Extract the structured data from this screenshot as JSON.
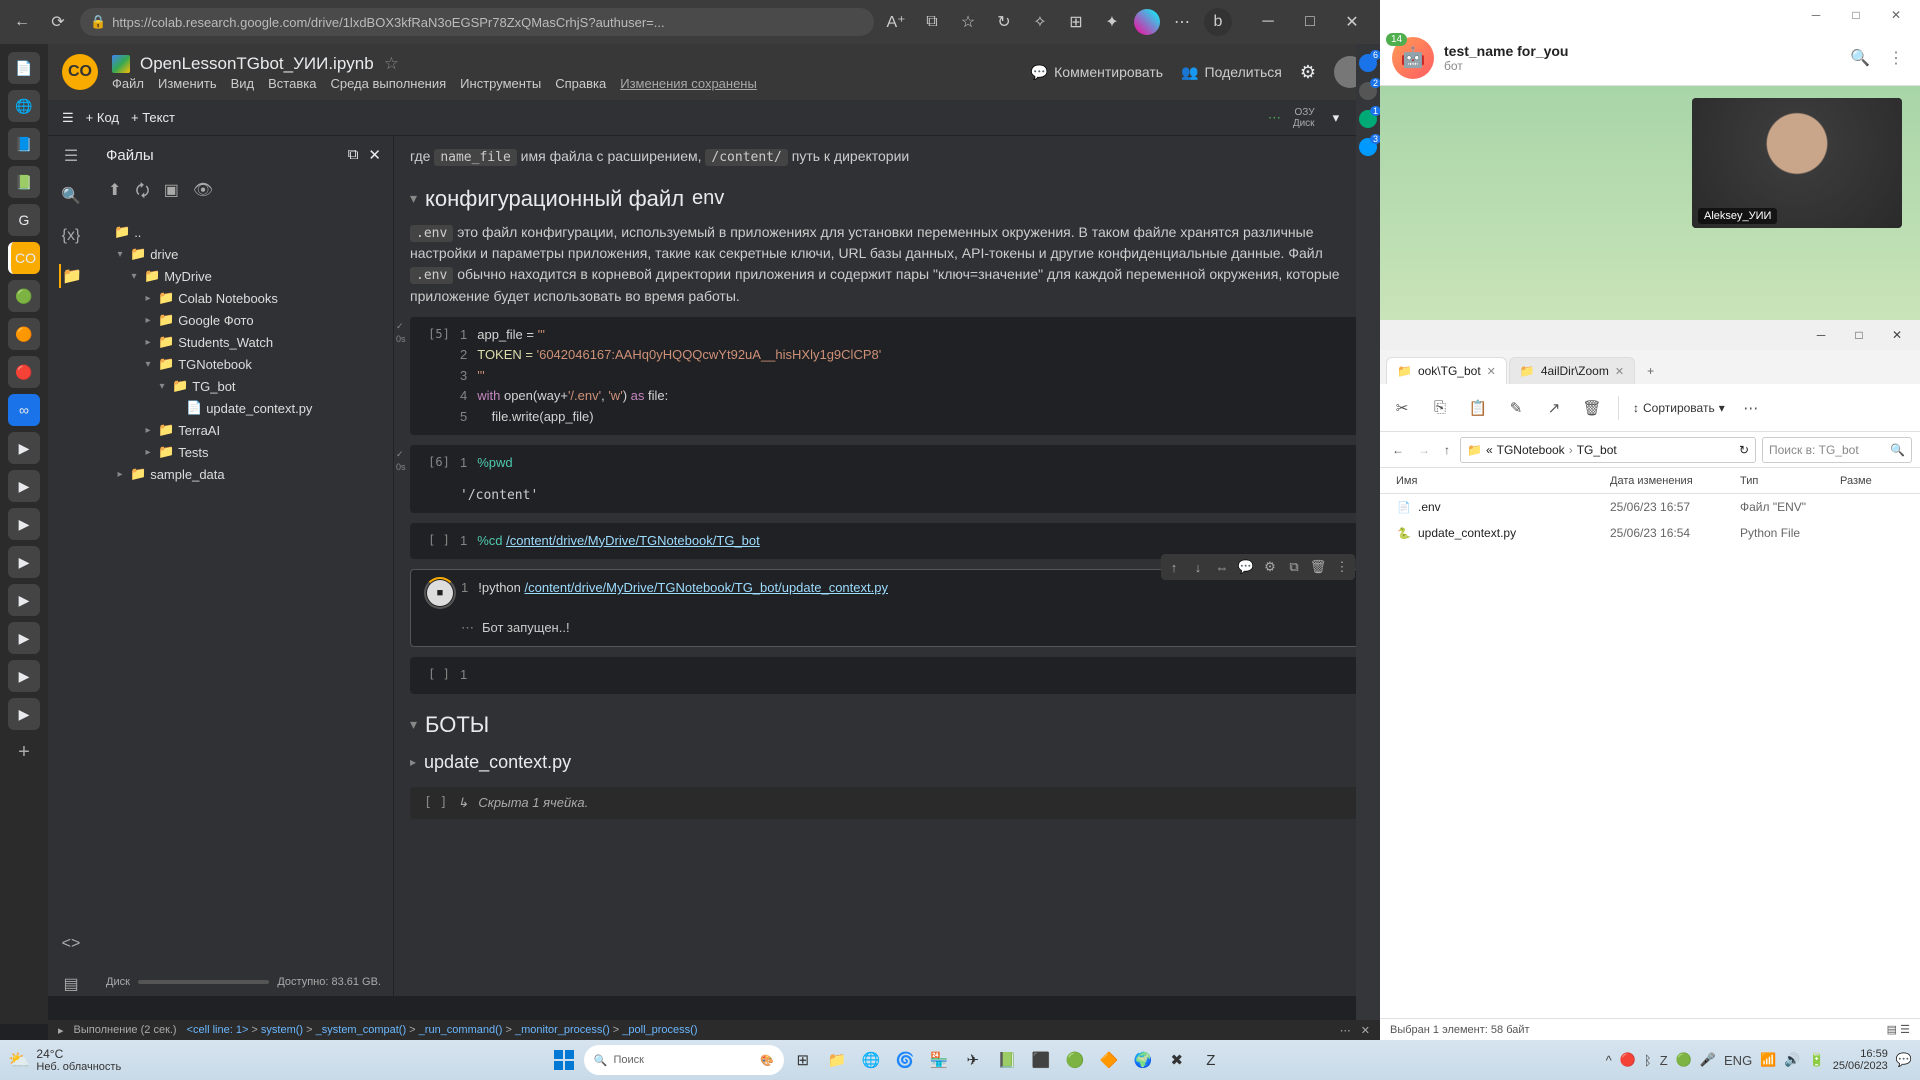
{
  "browser": {
    "url": "https://colab.research.google.com/drive/1lxdBOX3kfRaN3oEGSPr78ZxQMasCrhjS?authuser=..."
  },
  "colab": {
    "doc_title": "OpenLessonTGbot_УИИ.ipynb",
    "menu": {
      "file": "Файл",
      "edit": "Изменить",
      "view": "Вид",
      "insert": "Вставка",
      "runtime": "Среда выполнения",
      "tools": "Инструменты",
      "help": "Справка",
      "saved": "Изменения сохранены"
    },
    "top_actions": {
      "comment": "Комментировать",
      "share": "Поделиться"
    },
    "toolbar": {
      "code": "Код",
      "text": "Текст",
      "ram_l1": "ОЗУ",
      "ram_l2": "Диск"
    },
    "files": {
      "title": "Файлы",
      "tree": {
        "up": "..",
        "drive": "drive",
        "mydrive": "MyDrive",
        "colab_nb": "Colab Notebooks",
        "gphoto": "Google Фото",
        "students": "Students_Watch",
        "tgnb": "TGNotebook",
        "tgbot": "TG_bot",
        "update": "update_context.py",
        "terra": "TerraAI",
        "tests": "Tests",
        "sample": "sample_data"
      },
      "disk_label": "Диск",
      "disk_free": "Доступно: 83.61 GB."
    },
    "notebook": {
      "intro_pre": "где ",
      "intro_code1": "name_file",
      "intro_mid": " имя файла с расширением, ",
      "intro_code2": "/content/",
      "intro_post": " путь к директории",
      "h_env_pre": "конфигурационный файл ",
      "h_env_code": "env",
      "env_p1": ".env",
      "env_txt1": " это файл конфигурации, используемый в приложениях для установки переменных окружения. В таком файле хранятся различные настройки и параметры приложения, такие как секретные ключи, URL базы данных, API-токены и другие конфиденциальные данные. Файл ",
      "env_p2": ".env",
      "env_txt2": " обычно находится в корневой директории приложения и содержит пары \"ключ=значение\" для каждой переменной окружения, которые приложение будет использовать во время работы.",
      "cell5_num": "[5]",
      "cell5_l1a": "app_file = ",
      "cell5_l1b": "'''",
      "cell5_l2a": "TOKEN = ",
      "cell5_l2b": "'6042046167:AAHq0yHQQQcwYt92uA__hisHXly1g9ClCP8'",
      "cell5_l3": "'''",
      "cell5_l4a": "with",
      "cell5_l4b": " open(way+",
      "cell5_l4c": "'/.env'",
      "cell5_l4d": ", ",
      "cell5_l4e": "'w'",
      "cell5_l4f": ") ",
      "cell5_l4g": "as",
      "cell5_l4h": " file:",
      "cell5_l5a": "    file.write(app_file)",
      "cell6_num": "[6]",
      "cell6_code": "%pwd",
      "cell6_out": "'/content'",
      "cell7_num": "[ ]",
      "cell7_pre": "%cd ",
      "cell7_path": "/content/drive/MyDrive/TGNotebook/TG_bot",
      "cell8_pre": "!python ",
      "cell8_path": "/content/drive/MyDrive/TGNotebook/TG_bot/update_context.py",
      "cell8_out": "Бот запущен..!",
      "cell9_num": "[ ]",
      "h_bots": "БОТЫ",
      "h_update": "update_context.py",
      "hidden_label": "Скрыта 1 ячейка.",
      "hidden_num": "[ ]"
    },
    "status": {
      "exec": "Выполнение (2 сек.)",
      "c1": "<cell line: 1>",
      "c2": "system()",
      "c3": "_system_compat()",
      "c4": "_run_command()",
      "c5": "_monitor_process()",
      "c6": "_poll_process()"
    }
  },
  "telegram": {
    "badge": "14",
    "name": "test_name for_you",
    "sub": "бот",
    "video_label": "Aleksey_УИИ"
  },
  "explorer": {
    "tab1": "ook\\TG_bot",
    "tab2": "4ailDir\\Zoom",
    "sort": "Сортировать",
    "crumb_pre": "« ",
    "crumb1": "TGNotebook",
    "crumb2": "TG_bot",
    "search_ph": "Поиск в: TG_bot",
    "col_name": "Имя",
    "col_date": "Дата изменения",
    "col_type": "Тип",
    "col_size": "Разме",
    "rows": [
      {
        "name": ".env",
        "date": "25/06/23 16:57",
        "type": "Файл \"ENV\""
      },
      {
        "name": "update_context.py",
        "date": "25/06/23 16:54",
        "type": "Python File"
      }
    ],
    "status": "Выбран 1 элемент: 58 байт"
  },
  "taskbar": {
    "temp": "24°C",
    "weather": "Неб. облачность",
    "search": "Поиск",
    "lang": "ENG",
    "time": "16:59",
    "date": "25/06/2023"
  }
}
